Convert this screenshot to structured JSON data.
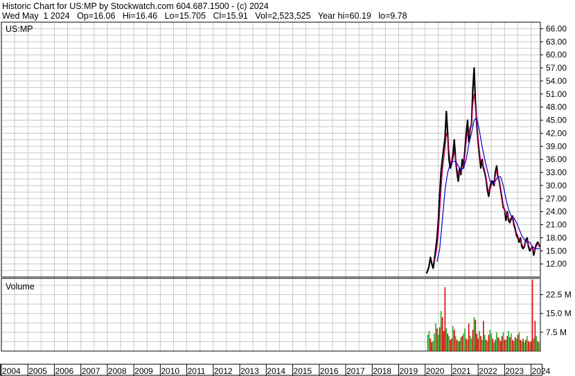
{
  "header": {
    "line1": "Historic Chart for US:MP by Stockwatch.com 604.687.1500 - (c) 2024",
    "line2": "Wed May  1 2024   Op=16.06   Hi=16.46   Lo=15.705   Cl=15.91   Vol=2,523,525   Year hi=60.19   lo=9.78"
  },
  "colors": {
    "grid": "#c8c8c8",
    "price": "#000000",
    "ma_short": "#cc0066",
    "ma_long": "#0000cc",
    "vol_up": "#22aa22",
    "vol_down": "#dd0000"
  },
  "chart_data": [
    {
      "type": "line",
      "panel_label": "US:MP",
      "y_ticks": [
        "66.00",
        "63.00",
        "60.00",
        "57.00",
        "54.00",
        "51.00",
        "48.00",
        "45.00",
        "42.00",
        "39.00",
        "36.00",
        "33.00",
        "30.00",
        "27.00",
        "24.00",
        "21.00",
        "18.00",
        "15.00",
        "12.00"
      ],
      "ylim": [
        9,
        67.5
      ],
      "x_ticks": [
        "2004",
        "2005",
        "2006",
        "2007",
        "2008",
        "2009",
        "2010",
        "2011",
        "2012",
        "2013",
        "2014",
        "2015",
        "2016",
        "2017",
        "2018",
        "2019",
        "2020",
        "2021",
        "2022",
        "2023",
        "2024"
      ],
      "xlim": [
        2004.0,
        2024.35
      ],
      "series": [
        {
          "key": "price",
          "x": [
            2020.05,
            2020.1,
            2020.15,
            2020.2,
            2020.25,
            2020.3,
            2020.35,
            2020.4,
            2020.45,
            2020.5,
            2020.55,
            2020.6,
            2020.65,
            2020.7,
            2020.75,
            2020.8,
            2020.85,
            2020.9,
            2020.95,
            2021.0,
            2021.05,
            2021.1,
            2021.15,
            2021.2,
            2021.25,
            2021.3,
            2021.35,
            2021.4,
            2021.45,
            2021.5,
            2021.55,
            2021.6,
            2021.65,
            2021.7,
            2021.75,
            2021.8,
            2021.85,
            2021.9,
            2021.95,
            2022.0,
            2022.05,
            2022.1,
            2022.15,
            2022.2,
            2022.25,
            2022.3,
            2022.35,
            2022.4,
            2022.45,
            2022.5,
            2022.55,
            2022.6,
            2022.65,
            2022.7,
            2022.75,
            2022.8,
            2022.85,
            2022.9,
            2022.95,
            2023.0,
            2023.05,
            2023.1,
            2023.15,
            2023.2,
            2023.25,
            2023.3,
            2023.35,
            2023.4,
            2023.45,
            2023.5,
            2023.55,
            2023.6,
            2023.65,
            2023.7,
            2023.75,
            2023.8,
            2023.85,
            2023.9,
            2023.95,
            2024.0,
            2024.05,
            2024.1,
            2024.15,
            2024.2,
            2024.25,
            2024.33
          ],
          "values": [
            9.8,
            10.5,
            11.5,
            13.5,
            12.0,
            11.0,
            13.0,
            15.5,
            18.0,
            22.0,
            28.0,
            33.0,
            36.0,
            38.5,
            41.0,
            47.0,
            42.0,
            36.0,
            34.0,
            35.0,
            37.0,
            40.5,
            36.0,
            33.0,
            31.0,
            34.0,
            32.5,
            36.0,
            34.0,
            38.0,
            42.0,
            45.0,
            40.0,
            43.0,
            44.0,
            52.0,
            57.0,
            49.0,
            44.0,
            40.0,
            37.0,
            34.0,
            36.0,
            34.0,
            33.0,
            31.5,
            29.0,
            27.5,
            29.5,
            31.0,
            31.0,
            30.0,
            33.0,
            34.5,
            32.0,
            31.0,
            29.0,
            27.0,
            25.0,
            24.5,
            22.0,
            24.0,
            22.0,
            21.5,
            22.5,
            23.0,
            21.0,
            20.0,
            18.5,
            18.0,
            17.0,
            18.0,
            16.0,
            15.5,
            16.0,
            17.5,
            18.0,
            16.0,
            15.0,
            15.5,
            16.0,
            14.0,
            15.5,
            16.5,
            17.0,
            15.9
          ]
        },
        {
          "key": "ma_short",
          "x": [
            2020.35,
            2020.4,
            2020.45,
            2020.5,
            2020.55,
            2020.6,
            2020.65,
            2020.7,
            2020.75,
            2020.8,
            2020.85,
            2020.9,
            2020.95,
            2021.0,
            2021.05,
            2021.1,
            2021.15,
            2021.2,
            2021.25,
            2021.3,
            2021.35,
            2021.4,
            2021.45,
            2021.5,
            2021.55,
            2021.6,
            2021.65,
            2021.7,
            2021.75,
            2021.8,
            2021.85,
            2021.9,
            2021.95,
            2022.0,
            2022.05,
            2022.1,
            2022.15,
            2022.2,
            2022.25,
            2022.3,
            2022.35,
            2022.4,
            2022.45,
            2022.5,
            2022.55,
            2022.6,
            2022.65,
            2022.7,
            2022.75,
            2022.8,
            2022.85,
            2022.9,
            2022.95,
            2023.0,
            2023.05,
            2023.1,
            2023.15,
            2023.2,
            2023.25,
            2023.3,
            2023.35,
            2023.4,
            2023.45,
            2023.5,
            2023.55,
            2023.6,
            2023.65,
            2023.7,
            2023.75,
            2023.8,
            2023.85,
            2023.9,
            2023.95,
            2024.0,
            2024.05,
            2024.1,
            2024.15,
            2024.2,
            2024.25,
            2024.33
          ],
          "values": [
            12.5,
            14.0,
            16.0,
            19.0,
            24.0,
            29.0,
            33.0,
            36.0,
            38.5,
            42.0,
            41.0,
            38.0,
            35.5,
            35.0,
            36.0,
            37.5,
            36.5,
            34.0,
            32.5,
            33.0,
            33.0,
            34.5,
            34.5,
            36.5,
            40.0,
            42.5,
            41.5,
            42.5,
            44.0,
            48.5,
            51.0,
            48.0,
            44.5,
            41.0,
            38.0,
            35.5,
            35.5,
            34.5,
            33.5,
            32.0,
            30.0,
            28.5,
            29.0,
            30.0,
            30.5,
            30.5,
            32.0,
            33.5,
            32.5,
            31.0,
            29.5,
            27.5,
            25.5,
            24.5,
            23.0,
            23.5,
            22.5,
            22.0,
            22.0,
            22.5,
            21.5,
            20.5,
            19.0,
            18.5,
            17.5,
            17.5,
            16.5,
            16.0,
            16.0,
            17.0,
            17.5,
            16.5,
            15.5,
            15.5,
            15.8,
            14.8,
            15.3,
            16.0,
            16.6,
            16.1
          ]
        },
        {
          "key": "ma_long",
          "x": [
            2020.45,
            2020.55,
            2020.65,
            2020.75,
            2020.85,
            2020.95,
            2021.05,
            2021.15,
            2021.25,
            2021.35,
            2021.45,
            2021.55,
            2021.65,
            2021.75,
            2021.85,
            2021.95,
            2022.05,
            2022.15,
            2022.25,
            2022.35,
            2022.45,
            2022.55,
            2022.65,
            2022.75,
            2022.85,
            2022.95,
            2023.05,
            2023.15,
            2023.25,
            2023.35,
            2023.45,
            2023.55,
            2023.65,
            2023.75,
            2023.85,
            2023.95,
            2024.05,
            2024.15,
            2024.25,
            2024.33
          ],
          "values": [
            12.5,
            15.5,
            22.0,
            29.0,
            33.0,
            35.0,
            35.5,
            35.5,
            34.5,
            33.5,
            34.0,
            36.0,
            39.5,
            42.0,
            45.0,
            45.5,
            42.5,
            39.0,
            36.0,
            33.5,
            31.0,
            30.5,
            31.0,
            32.0,
            32.0,
            30.0,
            27.0,
            24.5,
            23.0,
            22.5,
            21.5,
            20.0,
            18.5,
            17.5,
            17.0,
            17.0,
            16.0,
            15.5,
            15.5,
            15.5
          ]
        }
      ]
    },
    {
      "type": "bar",
      "panel_label": "Volume",
      "y_ticks": [
        "22.5 M",
        "15.0 M",
        "7.5 M"
      ],
      "ylim": [
        0,
        29
      ],
      "x_ticks": [
        "2004",
        "2005",
        "2006",
        "2007",
        "2008",
        "2009",
        "2010",
        "2011",
        "2012",
        "2013",
        "2014",
        "2015",
        "2016",
        "2017",
        "2018",
        "2019",
        "2020",
        "2021",
        "2022",
        "2023",
        "2024"
      ],
      "xlim": [
        2004.0,
        2024.35
      ],
      "unit": "M",
      "series": [
        {
          "key": "volume",
          "x": [
            2020.1,
            2020.15,
            2020.2,
            2020.25,
            2020.3,
            2020.35,
            2020.4,
            2020.45,
            2020.5,
            2020.55,
            2020.6,
            2020.65,
            2020.7,
            2020.75,
            2020.8,
            2020.85,
            2020.9,
            2020.95,
            2021.0,
            2021.05,
            2021.1,
            2021.15,
            2021.2,
            2021.25,
            2021.3,
            2021.35,
            2021.4,
            2021.45,
            2021.5,
            2021.55,
            2021.6,
            2021.65,
            2021.7,
            2021.75,
            2021.8,
            2021.85,
            2021.9,
            2021.95,
            2022.0,
            2022.05,
            2022.1,
            2022.15,
            2022.2,
            2022.25,
            2022.3,
            2022.35,
            2022.4,
            2022.45,
            2022.5,
            2022.55,
            2022.6,
            2022.65,
            2022.7,
            2022.75,
            2022.8,
            2022.85,
            2022.9,
            2022.95,
            2023.0,
            2023.05,
            2023.1,
            2023.15,
            2023.2,
            2023.25,
            2023.3,
            2023.35,
            2023.4,
            2023.45,
            2023.5,
            2023.55,
            2023.6,
            2023.65,
            2023.7,
            2023.75,
            2023.8,
            2023.85,
            2023.9,
            2023.95,
            2024.0,
            2024.05,
            2024.1,
            2024.15,
            2024.2,
            2024.25,
            2024.3
          ],
          "values": [
            6.5,
            8.0,
            5.0,
            3.5,
            4.0,
            7.0,
            11.0,
            9.0,
            6.5,
            9.5,
            16.0,
            13.5,
            8.0,
            25.5,
            9.0,
            7.0,
            6.0,
            4.5,
            5.0,
            10.0,
            8.5,
            6.0,
            4.5,
            4.0,
            4.0,
            5.5,
            6.0,
            7.0,
            9.0,
            5.0,
            4.5,
            11.0,
            6.0,
            5.0,
            8.5,
            13.5,
            12.5,
            7.0,
            5.0,
            8.0,
            6.0,
            4.5,
            12.0,
            6.5,
            4.5,
            4.0,
            6.5,
            8.5,
            7.0,
            5.0,
            3.5,
            4.5,
            7.5,
            5.5,
            5.0,
            4.0,
            6.0,
            7.5,
            4.5,
            4.5,
            6.0,
            8.0,
            5.5,
            7.0,
            4.5,
            4.0,
            5.5,
            5.0,
            6.5,
            7.5,
            4.5,
            4.0,
            5.0,
            3.5,
            4.5,
            6.0,
            4.0,
            3.5,
            4.0,
            28.5,
            5.0,
            12.0,
            6.0,
            4.0,
            3.5
          ],
          "up": [
            true,
            true,
            false,
            false,
            true,
            true,
            true,
            false,
            true,
            false,
            true,
            false,
            false,
            false,
            true,
            false,
            true,
            false,
            false,
            true,
            false,
            true,
            false,
            true,
            false,
            true,
            false,
            true,
            true,
            false,
            true,
            false,
            true,
            true,
            false,
            true,
            false,
            false,
            false,
            true,
            false,
            true,
            false,
            true,
            false,
            true,
            false,
            true,
            true,
            false,
            true,
            false,
            true,
            false,
            true,
            false,
            false,
            true,
            false,
            true,
            false,
            true,
            false,
            true,
            false,
            true,
            false,
            true,
            false,
            true,
            false,
            true,
            false,
            true,
            false,
            true,
            false,
            true,
            false,
            false,
            true,
            false,
            true,
            false,
            true
          ]
        }
      ]
    }
  ]
}
